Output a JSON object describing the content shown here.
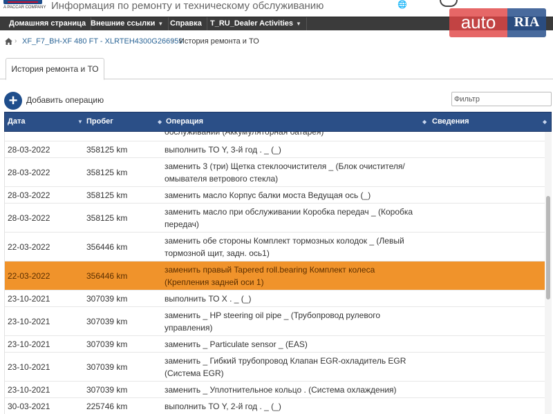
{
  "header": {
    "logo_subtext": "A PACCAR COMPANY",
    "title": "Информация по ремонту и техническому обслуживанию"
  },
  "watermark": {
    "part1": "auto",
    "part2": "RIA"
  },
  "nav": {
    "items": [
      {
        "label": "Домашняя страница",
        "dropdown": false
      },
      {
        "label": "Внешние ссылки",
        "dropdown": true
      },
      {
        "label": "Справка",
        "dropdown": false
      },
      {
        "label": "T_RU_Dealer Activities",
        "dropdown": true
      }
    ]
  },
  "breadcrumb": {
    "vehicle": "XF_F7_BH-XF 480 FT - XLRTEH4300G266959",
    "current": "История ремонта и ТО"
  },
  "tabs": [
    {
      "label": "История ремонта и ТО",
      "active": true
    }
  ],
  "toolbar": {
    "add_label": "Добавить операцию",
    "filter_placeholder": "Фильтр"
  },
  "table": {
    "columns": {
      "date": "Дата",
      "mileage": "Пробег",
      "operation": "Операция",
      "info": "Сведения"
    },
    "rows": [
      {
        "date": "",
        "mileage": "",
        "operation": "обслуживании (Аккумуляторная батарея)",
        "info": "",
        "highlight": false,
        "clipped": true
      },
      {
        "date": "28-03-2022",
        "mileage": "358125 km",
        "operation": "выполнить ТО Y, 3-й год . _ (_)",
        "info": "",
        "highlight": false
      },
      {
        "date": "28-03-2022",
        "mileage": "358125 km",
        "operation": "заменить 3 (три) Щетка стеклоочистителя _ (Блок очистителя/ омывателя ветрового стекла)",
        "info": "",
        "highlight": false
      },
      {
        "date": "28-03-2022",
        "mileage": "358125 km",
        "operation": "заменить масло Корпус балки моста Ведущая ось (_)",
        "info": "",
        "highlight": false
      },
      {
        "date": "28-03-2022",
        "mileage": "358125 km",
        "operation": "заменить масло при обслуживании Коробка передач _ (Коробка передач)",
        "info": "",
        "highlight": false
      },
      {
        "date": "22-03-2022",
        "mileage": "356446 km",
        "operation": "заменить обе стороны Комплект тормозных колодок _ (Левый тормозной щит, задн. ось1)",
        "info": "",
        "highlight": false
      },
      {
        "date": "22-03-2022",
        "mileage": "356446 km",
        "operation": "заменить правый Tapered roll.bearing Комплект колеса (Крепления задней оси 1)",
        "info": "",
        "highlight": true
      },
      {
        "date": "23-10-2021",
        "mileage": "307039 km",
        "operation": "выполнить ТО X . _ (_)",
        "info": "",
        "highlight": false
      },
      {
        "date": "23-10-2021",
        "mileage": "307039 km",
        "operation": "заменить _ HP steering oil pipe _ (Трубопровод рулевого управления)",
        "info": "",
        "highlight": false
      },
      {
        "date": "23-10-2021",
        "mileage": "307039 km",
        "operation": "заменить _ Particulate sensor _ (EAS)",
        "info": "",
        "highlight": false
      },
      {
        "date": "23-10-2021",
        "mileage": "307039 km",
        "operation": "заменить _ Гибкий трубопровод Клапан EGR-охладитель EGR (Система EGR)",
        "info": "",
        "highlight": false
      },
      {
        "date": "23-10-2021",
        "mileage": "307039 km",
        "operation": "заменить _ Уплотнительное кольцо . (Система охлаждения)",
        "info": "",
        "highlight": false
      },
      {
        "date": "30-03-2021",
        "mileage": "225746 km",
        "operation": "выполнить ТО Y, 2-й год . _ (_)",
        "info": "",
        "highlight": false
      }
    ]
  }
}
